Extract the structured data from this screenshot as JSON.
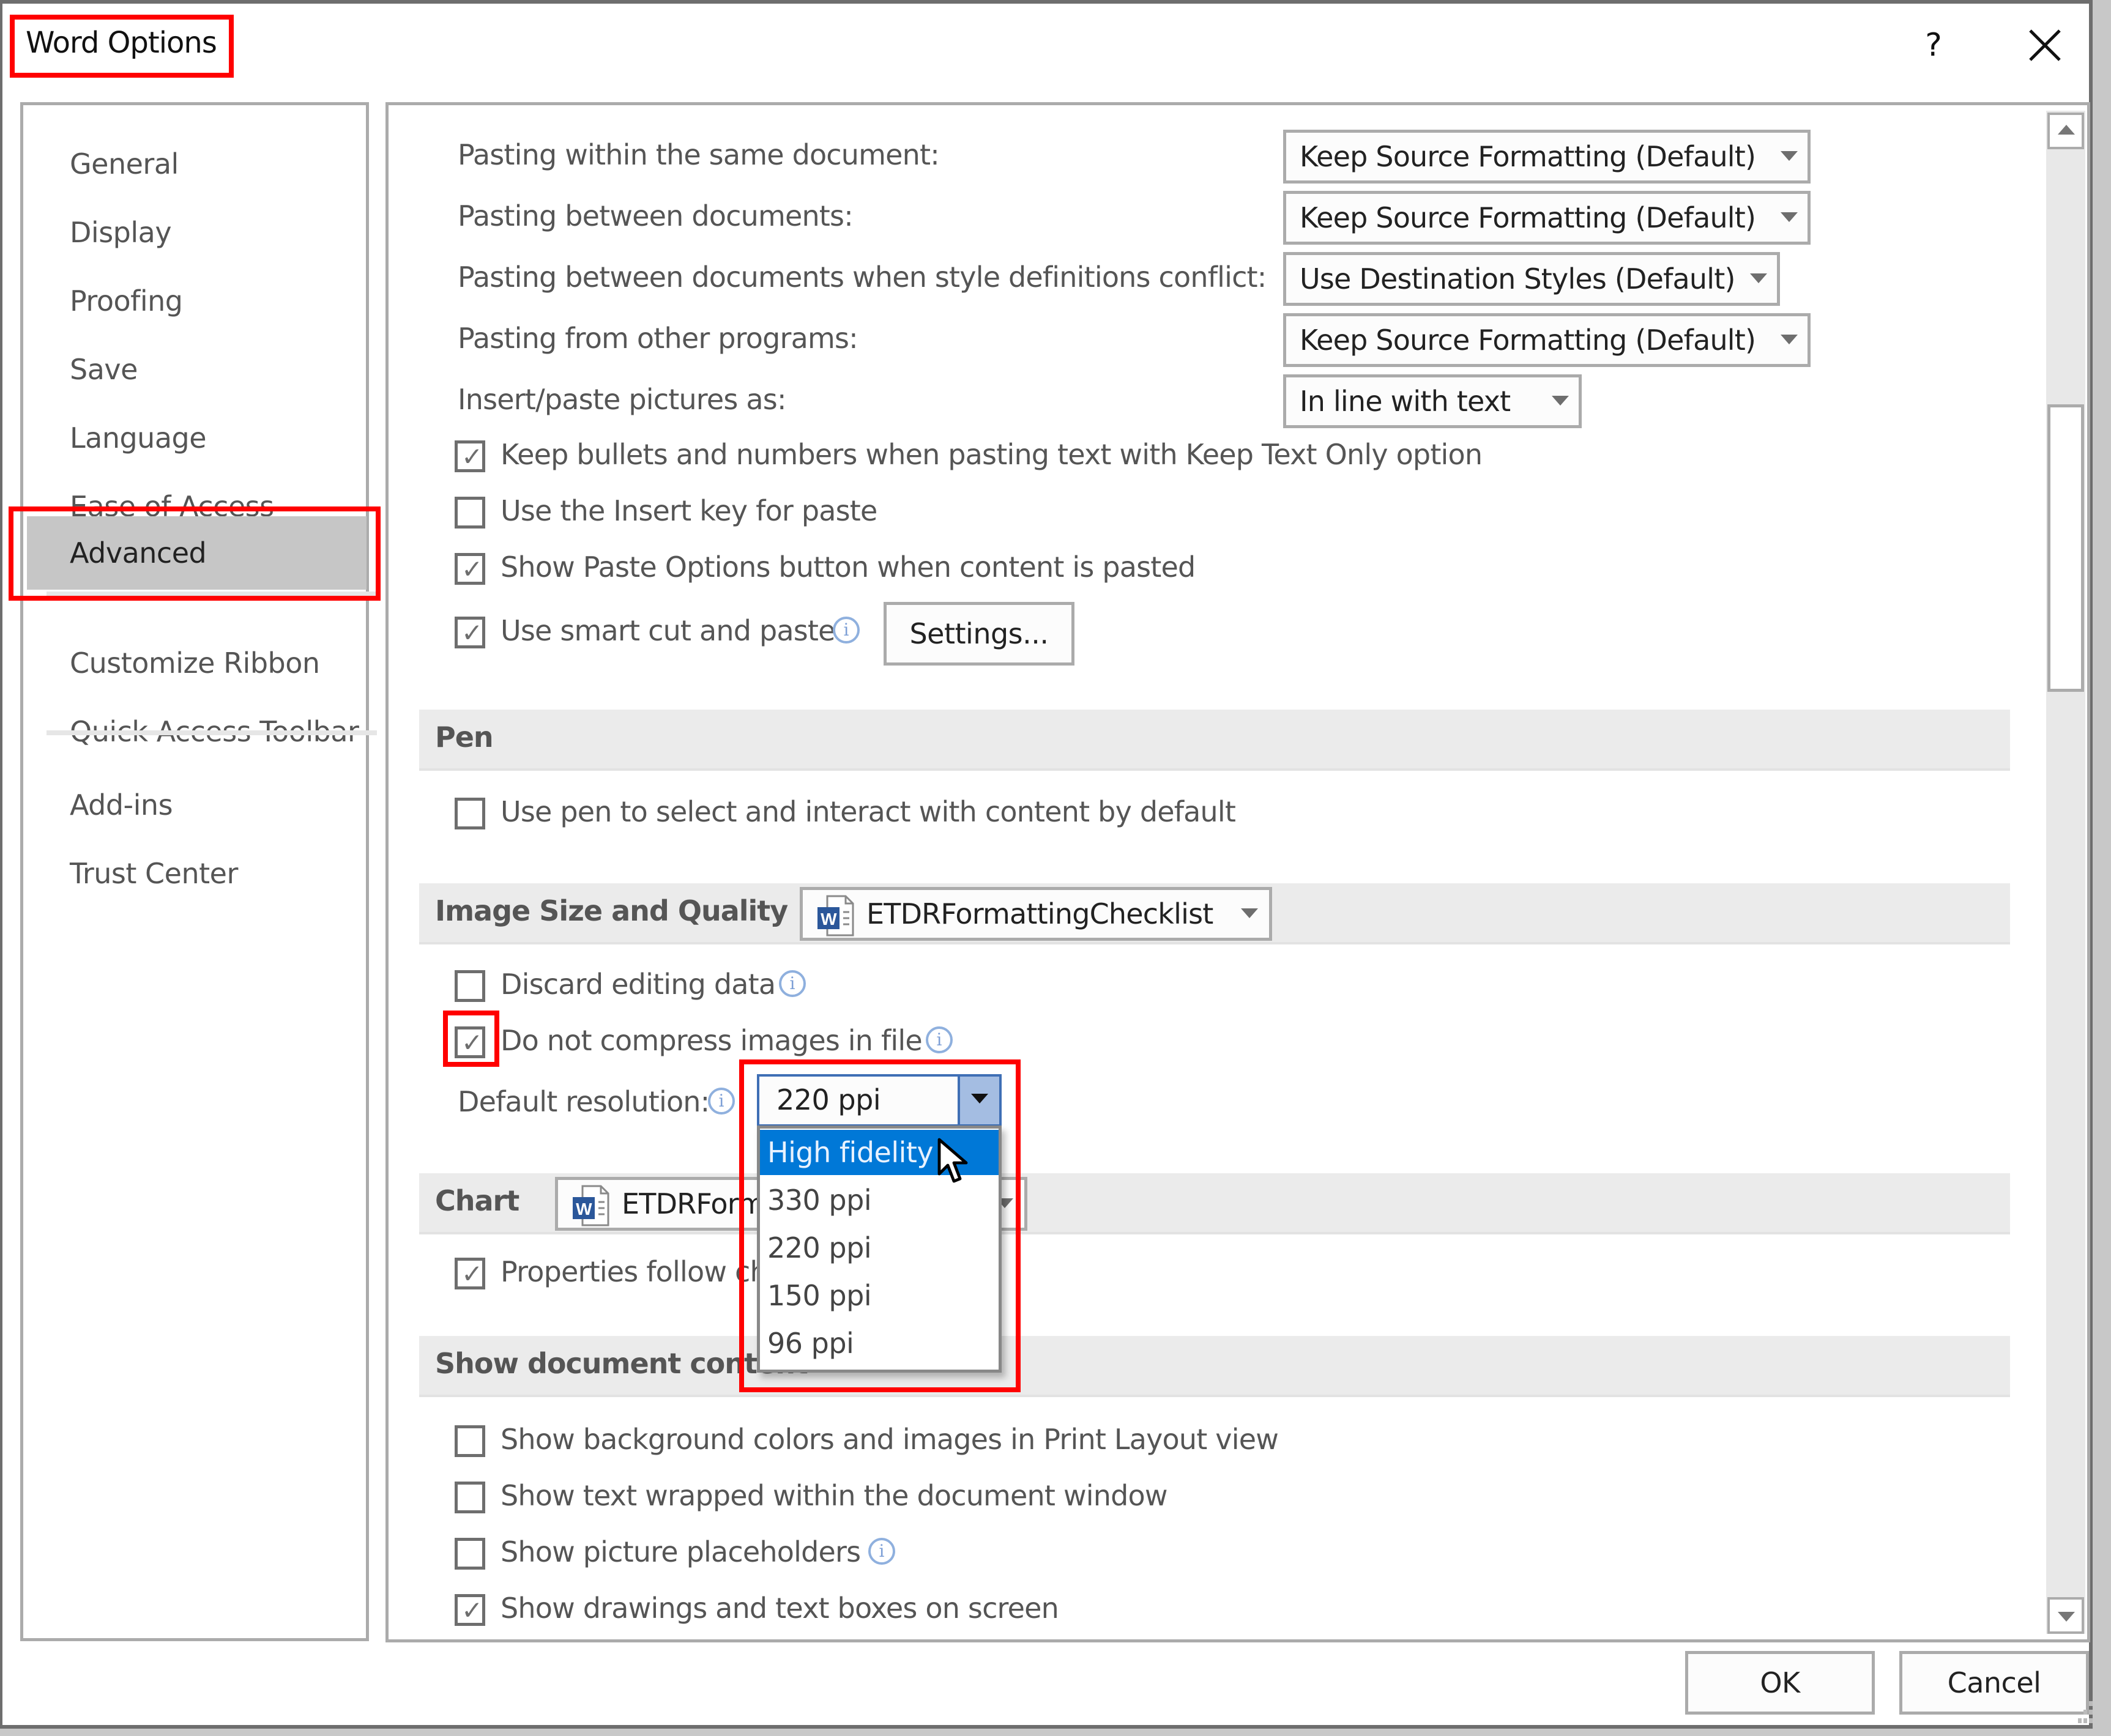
{
  "window": {
    "title": "Word Options",
    "help_label": "?",
    "close_label": "close"
  },
  "sidebar": {
    "items": [
      {
        "label": "General"
      },
      {
        "label": "Display"
      },
      {
        "label": "Proofing"
      },
      {
        "label": "Save"
      },
      {
        "label": "Language"
      },
      {
        "label": "Ease of Access"
      },
      {
        "label": "Advanced",
        "active": true
      },
      {
        "label": "Customize Ribbon"
      },
      {
        "label": "Quick Access Toolbar"
      },
      {
        "label": "Add-ins"
      },
      {
        "label": "Trust Center"
      }
    ]
  },
  "paste": {
    "rows": [
      {
        "label": "Pasting within the same document:",
        "value": "Keep Source Formatting (Default)"
      },
      {
        "label": "Pasting between documents:",
        "value": "Keep Source Formatting (Default)"
      },
      {
        "label": "Pasting between documents when style definitions conflict:",
        "value": "Use Destination Styles (Default)"
      },
      {
        "label": "Pasting from other programs:",
        "value": "Keep Source Formatting (Default)"
      },
      {
        "label": "Insert/paste pictures as:",
        "value": "In line with text"
      }
    ],
    "checks": [
      {
        "label": "Keep bullets and numbers when pasting text with Keep Text Only option",
        "checked": true
      },
      {
        "label": "Use the Insert key for paste",
        "checked": false
      },
      {
        "label": "Show Paste Options button when content is pasted",
        "checked": true
      },
      {
        "label": "Use smart cut and paste",
        "checked": true
      }
    ],
    "settings_button": "Settings..."
  },
  "pen": {
    "title": "Pen",
    "checks": [
      {
        "label": "Use pen to select and interact with content by default",
        "checked": false
      }
    ]
  },
  "image_quality": {
    "title": "Image Size and Quality",
    "document": "ETDRFormattingChecklist",
    "checks": [
      {
        "label": "Discard editing data",
        "checked": false
      },
      {
        "label": "Do not compress images in file",
        "checked": true
      }
    ],
    "resolution_label": "Default resolution:",
    "resolution_value": "220 ppi",
    "resolution_options": [
      "High fidelity",
      "330 ppi",
      "220 ppi",
      "150 ppi",
      "96 ppi"
    ],
    "highlighted_option": "High fidelity"
  },
  "chart": {
    "title": "Chart",
    "document": "ETDRFormattingChecklist",
    "checks": [
      {
        "label": "Properties follow chart data point",
        "checked": true
      }
    ]
  },
  "show_content": {
    "title": "Show document content",
    "checks": [
      {
        "label": "Show background colors and images in Print Layout view",
        "checked": false
      },
      {
        "label": "Show text wrapped within the document window",
        "checked": false
      },
      {
        "label": "Show picture placeholders",
        "checked": false
      },
      {
        "label": "Show drawings and text boxes on screen",
        "checked": true
      }
    ]
  },
  "footer": {
    "ok": "OK",
    "cancel": "Cancel"
  },
  "colors": {
    "highlight_red": "#ff0000",
    "selection_blue": "#0078d7",
    "sidebar_active": "#c6c6c6"
  }
}
